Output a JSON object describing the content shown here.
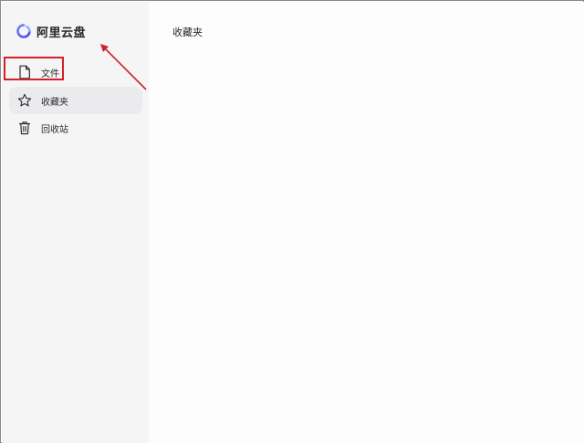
{
  "app": {
    "brand_name": "阿里云盘"
  },
  "sidebar": {
    "items": [
      {
        "label": "文件",
        "icon": "file-icon",
        "active": false
      },
      {
        "label": "收藏夹",
        "icon": "star-icon",
        "active": true
      },
      {
        "label": "回收站",
        "icon": "trash-icon",
        "active": false
      }
    ]
  },
  "main": {
    "title": "收藏夹"
  },
  "annotation": {
    "highlight_target": "文件",
    "color": "#d11f2b"
  },
  "colors": {
    "brand_accent": "#5b6cf0",
    "sidebar_bg": "#f5f5f6",
    "active_item_bg": "#ebebee"
  }
}
